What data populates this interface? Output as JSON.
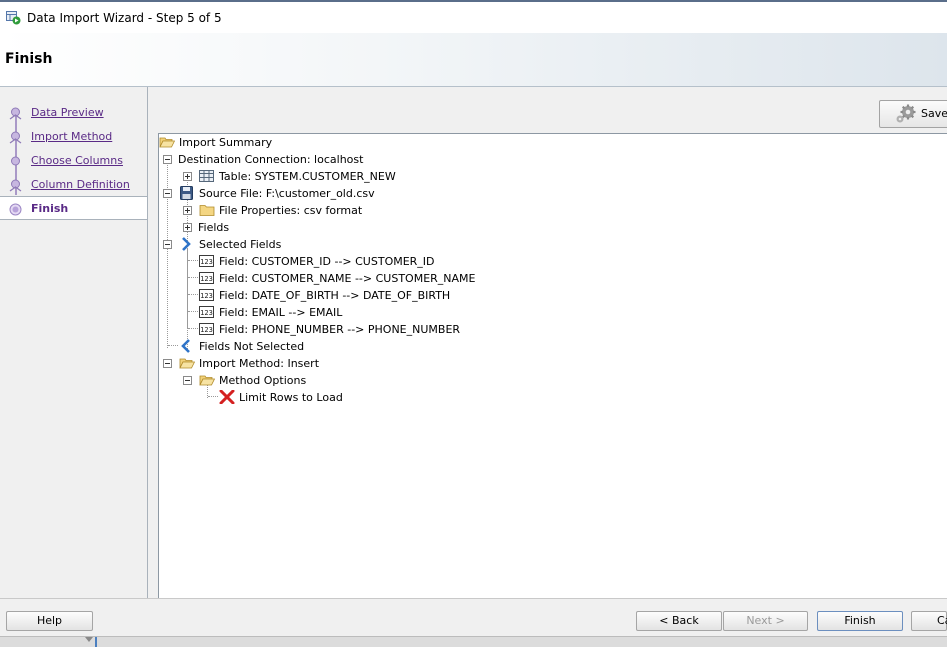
{
  "window": {
    "title": "Data Import Wizard - Step 5 of 5",
    "icon": "data-import-icon"
  },
  "header": {
    "title": "Finish"
  },
  "steps": [
    {
      "label": "Data Preview",
      "current": false
    },
    {
      "label": "Import Method",
      "current": false
    },
    {
      "label": "Choose Columns",
      "current": false
    },
    {
      "label": "Column Definition",
      "current": false
    },
    {
      "label": "Finish",
      "current": true
    }
  ],
  "toolbar": {
    "save_label": "Save"
  },
  "tree": {
    "root": "Import Summary",
    "destination": "Destination Connection: localhost",
    "table": "Table: SYSTEM.CUSTOMER_NEW",
    "source": "Source File: F:\\customer_old.csv",
    "file_properties": "File Properties: csv format",
    "fields": "Fields",
    "selected_fields": "Selected Fields",
    "field_mappings": [
      "Field: CUSTOMER_ID  --> CUSTOMER_ID",
      "Field: CUSTOMER_NAME  --> CUSTOMER_NAME",
      "Field: DATE_OF_BIRTH  --> DATE_OF_BIRTH",
      "Field: EMAIL  --> EMAIL",
      "Field: PHONE_NUMBER  --> PHONE_NUMBER"
    ],
    "fields_not_selected": "Fields Not Selected",
    "import_method": "Import Method: Insert",
    "method_options": "Method Options",
    "limit_rows": "Limit Rows to Load"
  },
  "footer": {
    "help_label": "Help",
    "back_label": "< Back",
    "next_label": "Next >",
    "finish_label": "Finish",
    "cancel_label": "Ca"
  },
  "colors": {
    "step_link": "#5a2a86",
    "header_gradient_end": "#dde5ec"
  }
}
